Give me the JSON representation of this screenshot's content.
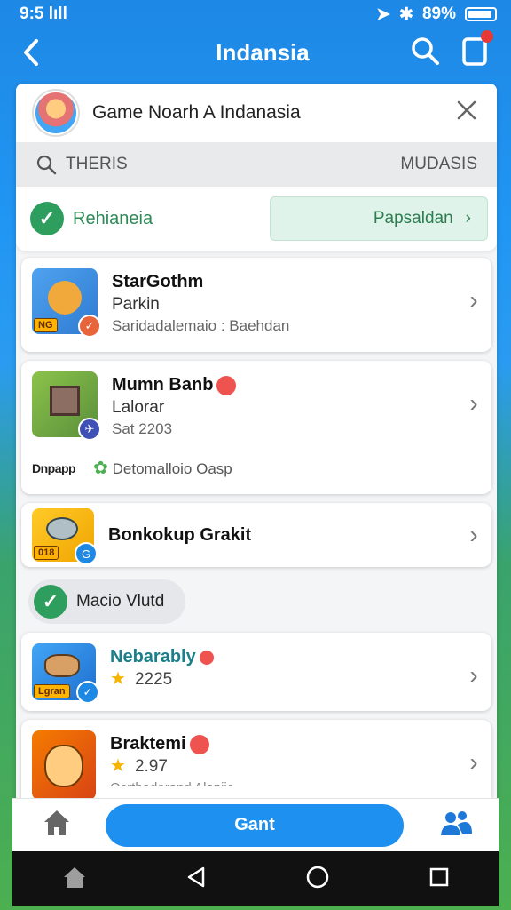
{
  "status_bar": {
    "time": "9:5 lıll",
    "battery": "89%"
  },
  "app_bar": {
    "title": "Indansia"
  },
  "card": {
    "header_title": "Game Noarh A Indanasia",
    "search_placeholder": "THERIS",
    "search_right": "MUDASIS",
    "filter_label": "Rehianeia",
    "filter_button": "Papsaldan"
  },
  "list": [
    {
      "title": "StarGothm",
      "subtitle": "Parkin",
      "meta": "Saridadalemaio : Baehdan",
      "tag": "NG"
    },
    {
      "title": "Mumn Banb",
      "subtitle": "Lalorar",
      "meta": "Sat 2203",
      "footer_brand": "Dnpapp",
      "footer_text": "Detomalloio Oasp"
    },
    {
      "title": "Bonkokup Grakit",
      "tag": "018"
    },
    {
      "title": "Nebarably",
      "meta": "2225",
      "tag": "Lgran"
    },
    {
      "title": "Braktemi",
      "meta": "2.97",
      "meta2": "Ocrthodorand Alaniie"
    }
  ],
  "section": {
    "label": "Macio Vlutd"
  },
  "bottom_bar": {
    "primary_button": "Gant"
  },
  "colors": {
    "accent": "#1e90f0",
    "green": "#2e9e5e",
    "primary_bg": "#2196f3"
  }
}
